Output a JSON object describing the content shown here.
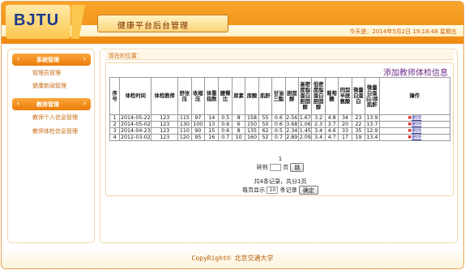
{
  "header": {
    "logo": "BJTU",
    "title": "健康平台后台管理",
    "datetime": "今天是：2014年5月2日  19:18:48  星期五"
  },
  "sidebar": {
    "sections": [
      {
        "label": "系统管理",
        "items": [
          "管理员管理",
          "健康新闻管理"
        ]
      },
      {
        "label": "教师管理",
        "items": [
          "教师个人信息管理",
          "教师体检信息管理"
        ]
      }
    ]
  },
  "main": {
    "location_label": "现在的位置：",
    "add_link": "添加教师体检信息",
    "table": {
      "headers": [
        "序号",
        "体检时间",
        "体检教师",
        "舒张压",
        "收缩压",
        "体重指数",
        "腰臀比",
        "尿素",
        "尿酸",
        "肌酐",
        "甘油三酯",
        "胆固醇",
        "高密度脂蛋白胆固醇",
        "低密度脂蛋白胆固醇",
        "葡萄糖",
        "同型半胱氨酸",
        "微量白蛋白",
        "微量白蛋白/尿肌酐",
        "操作"
      ],
      "rows": [
        [
          "1",
          "2014-05-22",
          "123",
          "115",
          "97",
          "14",
          "0.5",
          "8",
          "158",
          "55",
          "0.6",
          "2.56",
          "1.67",
          "3.2",
          "4.8",
          "34",
          "23",
          "13.9"
        ],
        [
          "2",
          "2014-05-02",
          "123",
          "130",
          "100",
          "13",
          "0.6",
          "6",
          "150",
          "50",
          "0.6",
          "3.68",
          "1.06",
          "2.3",
          "3.7",
          "20",
          "22",
          "13.7"
        ],
        [
          "3",
          "2014-04-23",
          "123",
          "110",
          "90",
          "15",
          "0.6",
          "8",
          "135",
          "62",
          "0.5",
          "2.34",
          "1.45",
          "3.4",
          "4.6",
          "33",
          "35",
          "12.9"
        ],
        [
          "4",
          "2012-03-02",
          "123",
          "120",
          "95",
          "16",
          "0.7",
          "10",
          "160",
          "52",
          "0.7",
          "2.89",
          "2.09",
          "3.4",
          "4.7",
          "17",
          "19",
          "13.4"
        ]
      ],
      "action_label": "删除",
      "action_icon": "delete-x-icon"
    },
    "pager": {
      "current_page": "1",
      "goto_prefix": "转到",
      "goto_suffix": "页",
      "jump_button": "跳",
      "summary": "共4条记录，共分1页",
      "per_page_prefix": "每页显示",
      "per_page_value": "10",
      "per_page_suffix": "条记录",
      "confirm_button": "确定"
    }
  },
  "footer": {
    "copyright": "CopyRight© 北京交通大学"
  }
}
